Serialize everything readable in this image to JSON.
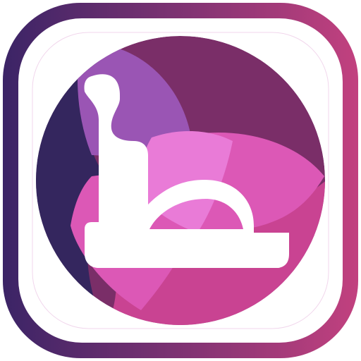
{
  "icon": {
    "name": "logo-mark",
    "glyph": "ط",
    "colors": {
      "frame_start": "#3b2466",
      "frame_end": "#c2417f",
      "navy": "#34265e",
      "plum": "#7a2e68",
      "violet": "#9a55b4",
      "magenta": "#dc58b6",
      "pink": "#e97bd7",
      "rose": "#c94392",
      "glyph": "#ffffff"
    }
  }
}
